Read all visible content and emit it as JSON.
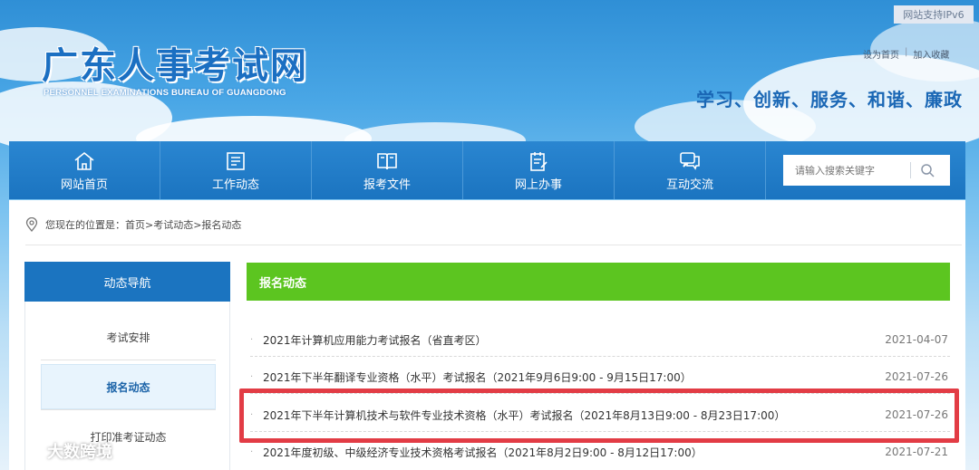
{
  "header": {
    "ipv6_badge": "网站支持IPv6",
    "logo_cn": "广东人事考试网",
    "logo_en": "PERSONNEL EXAMINATIONS BUREAU OF GUANGDONG",
    "links": {
      "set_home": "设为首页",
      "sep": "|",
      "favorite": "加入收藏"
    },
    "slogan": "学习、创新、服务、和谐、廉政"
  },
  "nav": {
    "items": [
      {
        "label": "网站首页",
        "icon": "home-icon"
      },
      {
        "label": "工作动态",
        "icon": "news-icon"
      },
      {
        "label": "报考文件",
        "icon": "book-icon"
      },
      {
        "label": "网上办事",
        "icon": "clipboard-icon"
      },
      {
        "label": "互动交流",
        "icon": "chat-icon"
      }
    ],
    "search": {
      "placeholder": "请输入搜索关键字",
      "icon": "search-icon"
    }
  },
  "breadcrumb": {
    "icon": "location-pin-icon",
    "text": "您现在的位置是：首页>考试动态>报名动态"
  },
  "sidebar": {
    "title": "动态导航",
    "items": [
      {
        "label": "考试安排",
        "active": false
      },
      {
        "label": "报名动态",
        "active": true
      },
      {
        "label": "打印准考证动态",
        "active": false
      }
    ]
  },
  "main": {
    "title": "报名动态",
    "rows": [
      {
        "bullet": "·",
        "title": "2021年计算机应用能力考试报名（省直考区）",
        "date": "2021-04-07"
      },
      {
        "bullet": "·",
        "title": "2021年下半年翻译专业资格（水平）考试报名（2021年9月6日9:00 - 9月15日17:00）",
        "date": "2021-07-26"
      },
      {
        "bullet": "·",
        "title": "2021年下半年计算机技术与软件专业技术资格（水平）考试报名（2021年8月13日9:00 - 8月23日17:00）",
        "date": "2021-07-26"
      },
      {
        "bullet": "·",
        "title": "2021年度初级、中级经济专业技术资格考试报名（2021年8月2日9:00 - 8月12日17:00）",
        "date": "2021-07-21"
      }
    ]
  },
  "watermark": {
    "text": "大数跨境",
    "icon": "bubble-logo-icon"
  },
  "colors": {
    "nav_blue": "#1b74c0",
    "green_header": "#5cc520",
    "highlight_red": "#e23c45"
  }
}
